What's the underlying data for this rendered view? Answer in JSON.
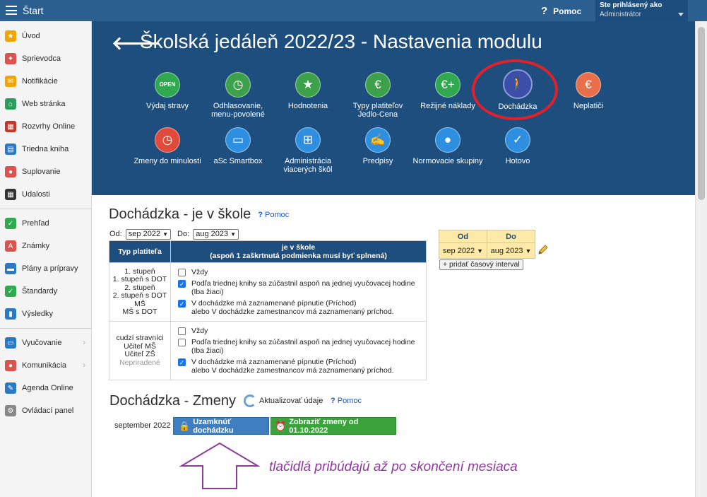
{
  "topbar": {
    "start_label": "Štart",
    "help_label": "Pomoc",
    "user_line1": "Ste prihlásený ako",
    "user_line2": "Administrátor"
  },
  "sidebar": {
    "items": [
      {
        "label": "Úvod",
        "icon": "star-icon",
        "color": "#f0a500"
      },
      {
        "label": "Sprievodca",
        "icon": "wand-icon",
        "color": "#d9534f"
      },
      {
        "label": "Notifikácie",
        "icon": "envelope-icon",
        "color": "#f0a500"
      },
      {
        "label": "Web stránka",
        "icon": "home-icon",
        "color": "#2a9d5b"
      },
      {
        "label": "Rozvrhy Online",
        "icon": "grid-icon",
        "color": "#c0392b"
      },
      {
        "label": "Triedna kniha",
        "icon": "book-icon",
        "color": "#2b78c5"
      },
      {
        "label": "Suplovanie",
        "icon": "person-icon",
        "color": "#d9534f"
      },
      {
        "label": "Udalosti",
        "icon": "calendar-icon",
        "color": "#333333"
      },
      {
        "label": "Prehľad",
        "icon": "check-circle-icon",
        "color": "#2fa84f"
      },
      {
        "label": "Známky",
        "icon": "grade-icon",
        "color": "#d9534f"
      },
      {
        "label": "Plány a prípravy",
        "icon": "briefcase-icon",
        "color": "#2b78c5"
      },
      {
        "label": "Štandardy",
        "icon": "shield-icon",
        "color": "#2fa84f"
      },
      {
        "label": "Výsledky",
        "icon": "bar-chart-icon",
        "color": "#2b78c5"
      },
      {
        "label": "Vyučovanie",
        "icon": "open-book-icon",
        "color": "#2b78c5"
      },
      {
        "label": "Komunikácia",
        "icon": "chat-icon",
        "color": "#d9534f"
      },
      {
        "label": "Agenda Online",
        "icon": "pen-icon",
        "color": "#2b78c5"
      },
      {
        "label": "Ovládací panel",
        "icon": "gear-icon",
        "color": "#888888"
      }
    ]
  },
  "header": {
    "title": "Školská jedáleň 2022/23 - Nastavenia modulu",
    "tiles": [
      {
        "label": "Výdaj stravy",
        "glyph": "OPEN",
        "color": "#2fa84f"
      },
      {
        "label": "Odhlasovanie, menu-povolené",
        "glyph": "◷",
        "color": "#3ca14a"
      },
      {
        "label": "Hodnotenia",
        "glyph": "★",
        "color": "#3ca14a"
      },
      {
        "label": "Typy platiteľov Jedlo-Cena",
        "glyph": "€",
        "color": "#3ca14a"
      },
      {
        "label": "Režijné náklady",
        "glyph": "€+",
        "color": "#2fa84f"
      },
      {
        "label": "Dochádzka",
        "glyph": "🚶",
        "color": "#3b4fa8"
      },
      {
        "label": "Neplatiči",
        "glyph": "€",
        "color": "#e86f4a"
      },
      {
        "label": "Zmeny do minulosti",
        "glyph": "◷",
        "color": "#e14a3a"
      },
      {
        "label": "aSc Smartbox",
        "glyph": "▭",
        "color": "#2e8fe0"
      },
      {
        "label": "Administrácia viacerých škôl",
        "glyph": "⊞",
        "color": "#2e8fe0"
      },
      {
        "label": "Predpisy",
        "glyph": "✍",
        "color": "#2e8fe0"
      },
      {
        "label": "Normovacie skupiny",
        "glyph": "●",
        "color": "#2e8fe0"
      },
      {
        "label": "Hotovo",
        "glyph": "✓",
        "color": "#2e8fe0"
      }
    ]
  },
  "attendance": {
    "title": "Dochádzka - je v škole",
    "help": "Pomoc",
    "from_label": "Od:",
    "from_value": "sep 2022",
    "to_label": "Do:",
    "to_value": "aug 2023",
    "col1": "Typ platiteľa",
    "col2_line1": "je v škole",
    "col2_line2": "(aspoň 1 zaškrtnutá podmienka musí byť splnená)",
    "group1_types": "1. stupeň\n1. stupeň s DOT\n2. stupeň\n2. stupeň s DOT\nMŠ\nMŠ s DOT",
    "group2_types": "cudzí stravníci\nUčiteľ MŠ\nUčiteľ ZŠ",
    "group2_unassigned": "Nepriradené",
    "opt1": "Vždy",
    "opt2": "Podľa triednej knihy sa zúčastnil aspoň na jednej vyučovacej hodine (Iba žiaci)",
    "opt3_line1": "V dochádzke má zaznamenané pípnutie (Príchod)",
    "opt3_line2": "alebo V dochádzke zamestnancov má zaznamenaný príchod.",
    "group1_checked": [
      false,
      true,
      true
    ],
    "group2_checked": [
      false,
      false,
      true
    ]
  },
  "interval": {
    "col_from": "Od",
    "col_to": "Do",
    "from_value": "sep 2022",
    "to_value": "aug 2023",
    "add_label": "+ pridať časový interval"
  },
  "changes": {
    "title": "Dochádzka - Zmeny",
    "refresh_label": "Aktualizovať údaje",
    "help": "Pomoc",
    "month": "september 2022",
    "lock_button": "Uzamknúť dochádzku",
    "show_button": "Zobraziť zmeny od 01.10.2022",
    "note": "tlačidlá pribúdajú až po skončení mesiaca"
  }
}
